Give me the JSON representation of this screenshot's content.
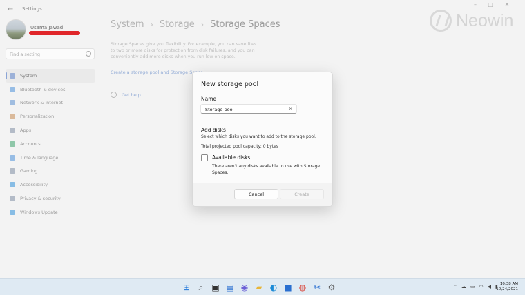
{
  "window": {
    "title": "Settings",
    "back": "←",
    "min": "–",
    "max": "□",
    "close": "✕"
  },
  "watermark": {
    "text": "Neowin"
  },
  "user": {
    "name": "Usama Jawad"
  },
  "search": {
    "placeholder": "Find a setting"
  },
  "sidebar": {
    "items": [
      {
        "label": "System",
        "icon": "monitor-icon",
        "color": "#5b82c8"
      },
      {
        "label": "Bluetooth & devices",
        "icon": "bluetooth-icon",
        "color": "#4a90d9"
      },
      {
        "label": "Network & internet",
        "icon": "wifi-icon",
        "color": "#5b8fd0"
      },
      {
        "label": "Personalization",
        "icon": "brush-icon",
        "color": "#c58a52"
      },
      {
        "label": "Apps",
        "icon": "apps-icon",
        "color": "#7d8ca3"
      },
      {
        "label": "Accounts",
        "icon": "person-icon",
        "color": "#3ca36b"
      },
      {
        "label": "Time & language",
        "icon": "globe-icon",
        "color": "#4a90d9"
      },
      {
        "label": "Gaming",
        "icon": "gamepad-icon",
        "color": "#7d8ca3"
      },
      {
        "label": "Accessibility",
        "icon": "accessibility-icon",
        "color": "#2f8fd8"
      },
      {
        "label": "Privacy & security",
        "icon": "shield-icon",
        "color": "#7d8ca3"
      },
      {
        "label": "Windows Update",
        "icon": "update-icon",
        "color": "#2f8fd8"
      }
    ]
  },
  "breadcrumb": {
    "items": [
      "System",
      "Storage",
      "Storage Spaces"
    ],
    "separator": "›"
  },
  "main": {
    "description": "Storage Spaces give you flexibility. For example, you can save files to two or more disks for protection from disk failures, and you can conveniently add more disks when you run low on space.",
    "create_link": "Create a storage pool and Storage Space",
    "help": "Get help"
  },
  "dialog": {
    "title": "New storage pool",
    "name_label": "Name",
    "name_value": "Storage pool",
    "clear": "✕",
    "add_disks_label": "Add disks",
    "add_disks_sub": "Select which disks you want to add to the storage pool.",
    "capacity": "Total projected pool capacity: 0 bytes",
    "available_label": "Available disks",
    "available_note": "There aren't any disks available to use with Storage Spaces.",
    "cancel": "Cancel",
    "create": "Create"
  },
  "taskbar": {
    "icons": [
      {
        "name": "start-icon",
        "glyph": "⊞",
        "color": "#1a73d9"
      },
      {
        "name": "search-icon",
        "glyph": "⌕",
        "color": "#222"
      },
      {
        "name": "task-view-icon",
        "glyph": "▣",
        "color": "#333"
      },
      {
        "name": "widgets-icon",
        "glyph": "▤",
        "color": "#2a6fd0"
      },
      {
        "name": "chat-icon",
        "glyph": "◉",
        "color": "#6b5fd6"
      },
      {
        "name": "file-explorer-icon",
        "glyph": "▰",
        "color": "#e8b63a"
      },
      {
        "name": "edge-icon",
        "glyph": "◐",
        "color": "#1b8ad6"
      },
      {
        "name": "store-icon",
        "glyph": "■",
        "color": "#2a6fd0"
      },
      {
        "name": "chrome-icon",
        "glyph": "◍",
        "color": "#d9453a"
      },
      {
        "name": "snipping-icon",
        "glyph": "✂",
        "color": "#2a6fd0"
      },
      {
        "name": "settings-icon",
        "glyph": "⚙",
        "color": "#555"
      }
    ],
    "tray": [
      "⌃",
      "☁",
      "▭",
      "◠",
      "◀",
      "▮"
    ],
    "time": "10:38 AM",
    "date": "10/24/2021"
  }
}
